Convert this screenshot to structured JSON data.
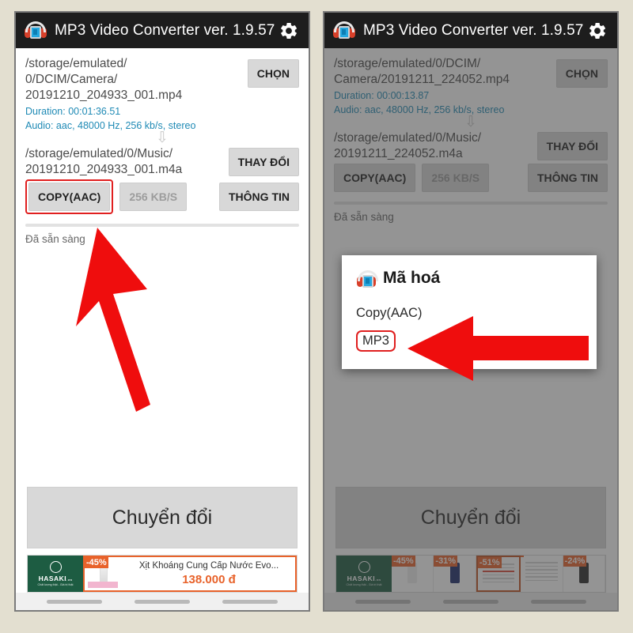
{
  "background_color": "#e3dfd0",
  "accent_color": "#e01f1f",
  "app": {
    "title": "MP3 Video Converter ver. 1.9.57",
    "icon": "headphones-app-icon",
    "settings_icon": "gear-icon"
  },
  "left_phone": {
    "source": {
      "path": "/storage/emulated/\n0/DCIM/Camera/\n20191210_204933_001.mp4",
      "duration": "Duration: 00:01:36.51",
      "audio": "Audio: aac, 48000 Hz, 256 kb/s, stereo",
      "choose_button": "CHỌN"
    },
    "flow_icon": "down-arrow-icon",
    "output": {
      "path": "/storage/emulated/0/Music/\n20191210_204933_001.m4a",
      "change_button": "THAY ĐỔI"
    },
    "controls": {
      "codec_button": "COPY(AAC)",
      "bitrate_button": "256 KB/S",
      "info_button": "THÔNG TIN"
    },
    "status": "Đã sẵn sàng",
    "convert_button": "Chuyển đổi",
    "ad": {
      "brand": "HASAKI",
      "brand_suffix": ".vn",
      "brand_tagline": "Chất lượng thật - Giá trị thật",
      "discount_badge": "-45%",
      "product_title": "Xịt Khoáng Cung Cấp Nước Evo...",
      "price": "138.000 đ"
    }
  },
  "right_phone": {
    "source": {
      "path": "/storage/emulated/0/DCIM/\nCamera/20191211_224052.mp4",
      "duration": "Duration: 00:00:13.87",
      "audio": "Audio: aac, 48000 Hz, 256 kb/s, stereo",
      "choose_button": "CHỌN"
    },
    "flow_icon": "down-arrow-icon",
    "output": {
      "path": "/storage/emulated/0/Music/\n20191211_224052.m4a",
      "change_button": "THAY ĐỔI"
    },
    "controls": {
      "codec_button": "COPY(AAC)",
      "bitrate_button": "256 KB/S",
      "info_button": "THÔNG TIN"
    },
    "status": "Đã sẵn sàng",
    "convert_button": "Chuyển đổi",
    "dialog": {
      "title": "Mã hoá",
      "icon": "headphones-app-icon",
      "options": [
        {
          "label": "Copy(AAC)",
          "highlighted": false
        },
        {
          "label": "MP3",
          "highlighted": true
        }
      ]
    },
    "ad": {
      "brand": "HASAKI",
      "brand_suffix": ".vn",
      "brand_tagline": "Chất lượng thật - Giá trị thật",
      "items": [
        {
          "badge": "-45%"
        },
        {
          "badge": "-31%"
        },
        {
          "badge": "-51%"
        },
        {
          "badge": ""
        },
        {
          "badge": "-24%"
        }
      ]
    }
  },
  "annotations": {
    "left_arrow": "red-arrow-pointing-to-copy-aac-button",
    "right_arrow": "red-arrow-pointing-to-mp3-option",
    "left_highlight": "red-box-around-copy-aac-button",
    "right_highlight": "red-box-around-mp3-option"
  }
}
